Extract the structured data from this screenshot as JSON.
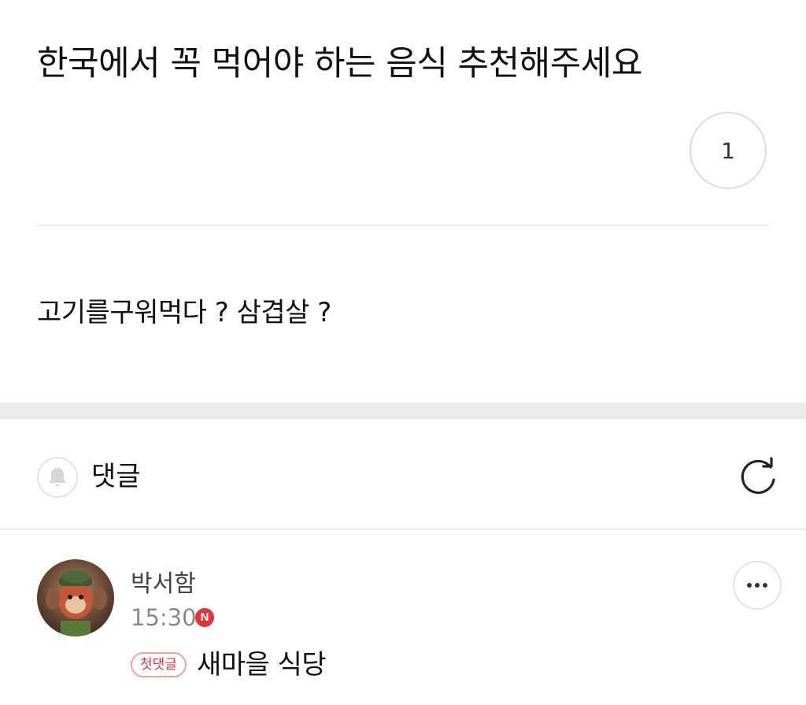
{
  "post": {
    "title": "한국에서 꼭 먹어야 하는 음식 추천해주세요",
    "like_count": "1",
    "body": "고기를구워먹다 ? 삼겹살 ?"
  },
  "comments_section": {
    "label": "댓글",
    "icons": {
      "notify": "bell-icon",
      "refresh": "refresh-icon",
      "more": "more-dots-icon"
    }
  },
  "comment": {
    "author": "박서함",
    "time": "15:30",
    "new_badge": "N",
    "first_comment_badge": "첫댓글",
    "text": "새마을 식당"
  },
  "colors": {
    "accent_red": "#e0353b",
    "divider": "#ececec",
    "section_gap": "#ebebed"
  }
}
